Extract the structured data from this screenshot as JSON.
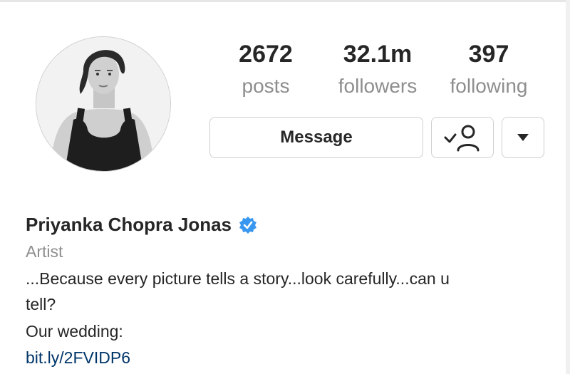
{
  "stats": {
    "posts": {
      "value": "2672",
      "label": "posts"
    },
    "followers": {
      "value": "32.1m",
      "label": "followers"
    },
    "following": {
      "value": "397",
      "label": "following"
    }
  },
  "actions": {
    "message_label": "Message",
    "follow_icon": "following-check-person-icon",
    "more_icon": "caret-down-icon"
  },
  "profile": {
    "name": "Priyanka Chopra Jonas",
    "verified_icon": "verified-badge-icon",
    "category": "Artist",
    "bio_lines": [
      "...Because every picture tells a story...look carefully...can u",
      "tell?",
      "Our wedding:"
    ],
    "link": "bit.ly/2FVIDP6"
  },
  "colors": {
    "text": "#262626",
    "secondary": "#8e8e8e",
    "link": "#003569",
    "verified": "#3897f0",
    "border": "#cfcfcf"
  }
}
